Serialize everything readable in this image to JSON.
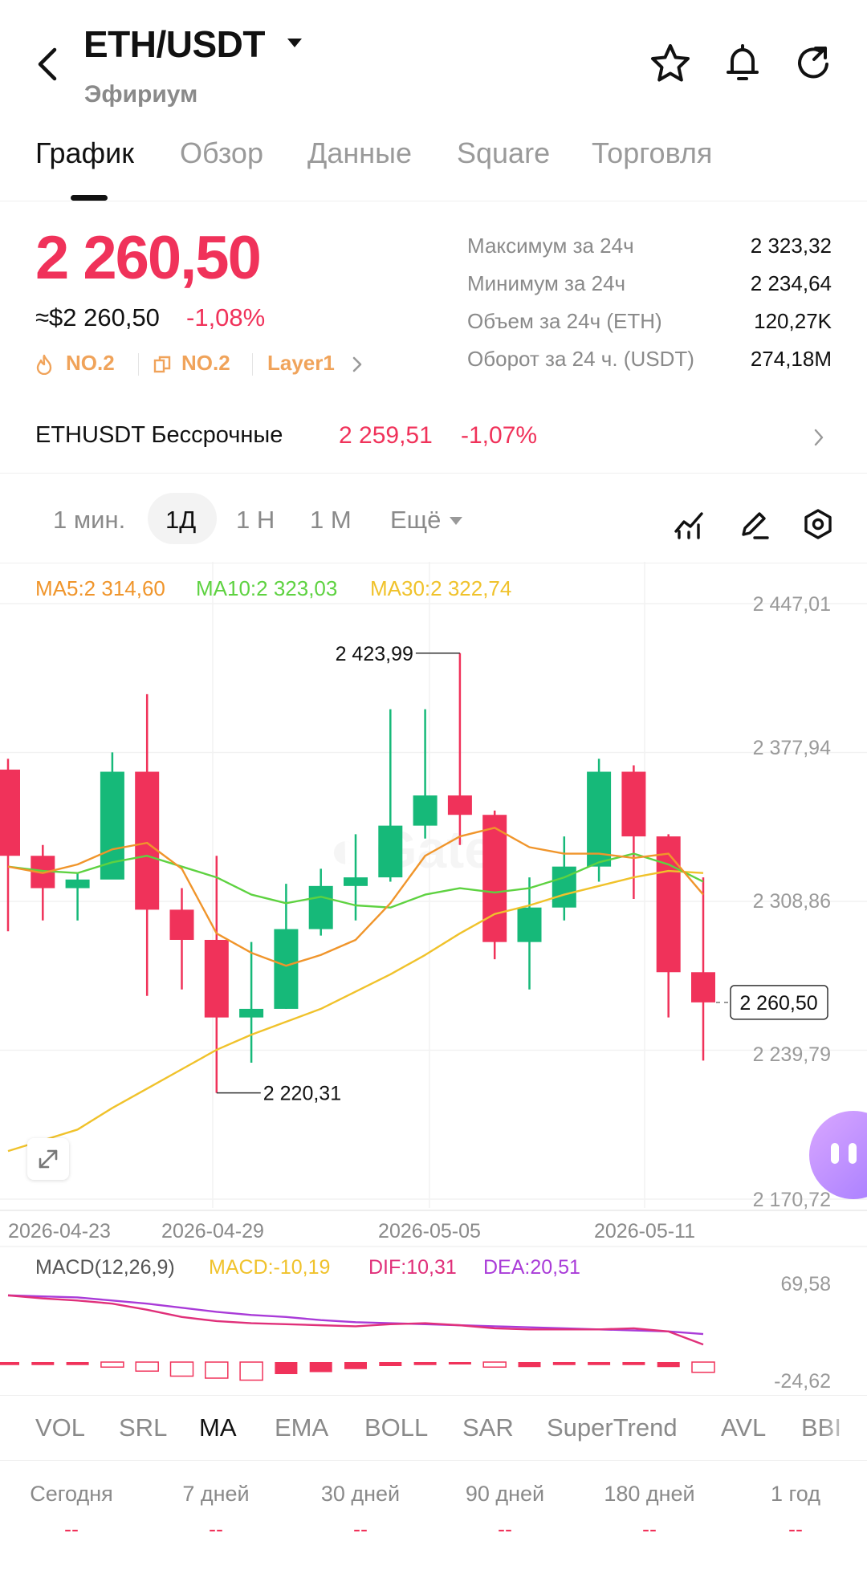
{
  "header": {
    "pair": "ETH/USDT",
    "subtitle": "Эфириум",
    "icons": [
      "back-arrow-icon",
      "caret-down-icon",
      "star-icon",
      "bell-icon",
      "refresh-icon"
    ]
  },
  "tabs": [
    {
      "label": "График",
      "active": true
    },
    {
      "label": "Обзор",
      "active": false
    },
    {
      "label": "Данные",
      "active": false
    },
    {
      "label": "Square",
      "active": false
    },
    {
      "label": "Торговля",
      "active": false
    }
  ],
  "price": {
    "last": "2 260,50",
    "usd": "≈$2 260,50",
    "change_pct": "-1,08%",
    "tags": [
      "NO.2",
      "NO.2",
      "Layer1"
    ]
  },
  "stats": [
    {
      "label": "Максимум за 24ч",
      "value": "2 323,32"
    },
    {
      "label": "Минимум за 24ч",
      "value": "2 234,64"
    },
    {
      "label": "Объем за 24ч (ETH)",
      "value": "120,27K"
    },
    {
      "label": "Оборот за 24 ч. (USDT)",
      "value": "274,18M"
    }
  ],
  "perpetual": {
    "name": "ETHUSDT Бессрочные",
    "price": "2 259,51",
    "change_pct": "-1,07%"
  },
  "intervals": [
    {
      "label": "1 мин.",
      "active": false
    },
    {
      "label": "1Д",
      "active": true
    },
    {
      "label": "1 Н",
      "active": false
    },
    {
      "label": "1 М",
      "active": false
    },
    {
      "label": "Ещё",
      "active": false
    }
  ],
  "ma_legend": {
    "ma5": "MA5:2 314,60",
    "ma10": "MA10:2 323,03",
    "ma30": "MA30:2 322,74"
  },
  "colors": {
    "up": "#16b979",
    "down": "#f0325a",
    "ma5": "#f0952b",
    "ma10": "#5ed241",
    "ma30": "#f0c22b",
    "macd": "#f0c22b",
    "dif": "#e0307a",
    "dea": "#a93bd8"
  },
  "chart_data": {
    "type": "candlestick",
    "y_ticks": [
      "2 447,01",
      "2 377,94",
      "2 308,86",
      "2 239,79",
      "2 170,72"
    ],
    "ylim": [
      2170.72,
      2447.01
    ],
    "x_ticks": [
      "2026-04-23",
      "2026-04-29",
      "2026-05-05",
      "2026-05-11"
    ],
    "high_label": "2 423,99",
    "low_label": "2 220,31",
    "current_label": "2 260,50",
    "candles": [
      {
        "o": 2370,
        "c": 2330,
        "h": 2375,
        "l": 2295
      },
      {
        "o": 2330,
        "c": 2315,
        "h": 2335,
        "l": 2300
      },
      {
        "o": 2315,
        "c": 2319,
        "h": 2322,
        "l": 2300
      },
      {
        "o": 2319,
        "c": 2369,
        "h": 2378,
        "l": 2323
      },
      {
        "o": 2369,
        "c": 2305,
        "h": 2405,
        "l": 2265
      },
      {
        "o": 2305,
        "c": 2291,
        "h": 2315,
        "l": 2268
      },
      {
        "o": 2291,
        "c": 2255,
        "h": 2330,
        "l": 2220
      },
      {
        "o": 2255,
        "c": 2259,
        "h": 2290,
        "l": 2234
      },
      {
        "o": 2259,
        "c": 2296,
        "h": 2317,
        "l": 2259
      },
      {
        "o": 2296,
        "c": 2316,
        "h": 2324,
        "l": 2293
      },
      {
        "o": 2316,
        "c": 2320,
        "h": 2340,
        "l": 2300
      },
      {
        "o": 2320,
        "c": 2344,
        "h": 2398,
        "l": 2318
      },
      {
        "o": 2344,
        "c": 2358,
        "h": 2398,
        "l": 2338
      },
      {
        "o": 2358,
        "c": 2349,
        "h": 2424,
        "l": 2335
      },
      {
        "o": 2349,
        "c": 2290,
        "h": 2351,
        "l": 2282
      },
      {
        "o": 2290,
        "c": 2306,
        "h": 2320,
        "l": 2268
      },
      {
        "o": 2306,
        "c": 2325,
        "h": 2339,
        "l": 2300
      },
      {
        "o": 2325,
        "c": 2369,
        "h": 2375,
        "l": 2318
      },
      {
        "o": 2369,
        "c": 2339,
        "h": 2372,
        "l": 2310
      },
      {
        "o": 2339,
        "c": 2276,
        "h": 2340,
        "l": 2255
      },
      {
        "o": 2276,
        "c": 2262,
        "h": 2320,
        "l": 2235
      }
    ],
    "ma5": [
      2325,
      2322,
      2326,
      2333,
      2336,
      2324,
      2294,
      2285,
      2279,
      2284,
      2291,
      2308,
      2330,
      2339,
      2343,
      2334,
      2331,
      2331,
      2329,
      2331,
      2312
    ],
    "ma10": [
      2325,
      2323,
      2322,
      2327,
      2330,
      2325,
      2320,
      2312,
      2308,
      2311,
      2307,
      2306,
      2312,
      2315,
      2313,
      2315,
      2320,
      2327,
      2331,
      2326,
      2318
    ],
    "ma30": [
      2193,
      2198,
      2203,
      2213,
      2222,
      2231,
      2240,
      2247,
      2253,
      2259,
      2267,
      2275,
      2284,
      2294,
      2303,
      2307,
      2312,
      2316,
      2320,
      2323,
      2322
    ]
  },
  "macd": {
    "legend": {
      "params": "MACD(12,26,9)",
      "macd": "MACD:-10,19",
      "dif": "DIF:10,31",
      "dea": "DEA:20,51"
    },
    "y_ticks": [
      "69,58",
      "-24,62"
    ],
    "ylim": [
      -24.62,
      69.58
    ],
    "dea": [
      58,
      57,
      56,
      53,
      50,
      46,
      42,
      39,
      37,
      34,
      32,
      31,
      30,
      29,
      28,
      27,
      26,
      25,
      24,
      23,
      20.51
    ],
    "dif": [
      58,
      55,
      53,
      50,
      44,
      37,
      33,
      31,
      30,
      29,
      28,
      30,
      31,
      29,
      26,
      25,
      25,
      25,
      26,
      23,
      10.31
    ],
    "hist": [
      -3,
      -3,
      -3,
      -5,
      -9,
      -14,
      -16,
      -18,
      -12,
      -10,
      -7,
      -4,
      -3,
      -2,
      -5,
      -5,
      -3,
      -3,
      -3,
      -5,
      -10.19
    ]
  },
  "indicators": [
    {
      "label": "VOL",
      "active": false
    },
    {
      "label": "SRL",
      "active": false
    },
    {
      "label": "MA",
      "active": true
    },
    {
      "label": "EMA",
      "active": false
    },
    {
      "label": "BOLL",
      "active": false
    },
    {
      "label": "SAR",
      "active": false
    },
    {
      "label": "SuperTrend",
      "active": false
    },
    {
      "label": "AVL",
      "active": false
    },
    {
      "label": "BBI",
      "active": false
    }
  ],
  "performance": [
    {
      "label": "Сегодня",
      "value": "--"
    },
    {
      "label": "7 дней",
      "value": "--"
    },
    {
      "label": "30 дней",
      "value": "--"
    },
    {
      "label": "90 дней",
      "value": "--"
    },
    {
      "label": "180 дней",
      "value": "--"
    },
    {
      "label": "1 год",
      "value": "--"
    }
  ]
}
